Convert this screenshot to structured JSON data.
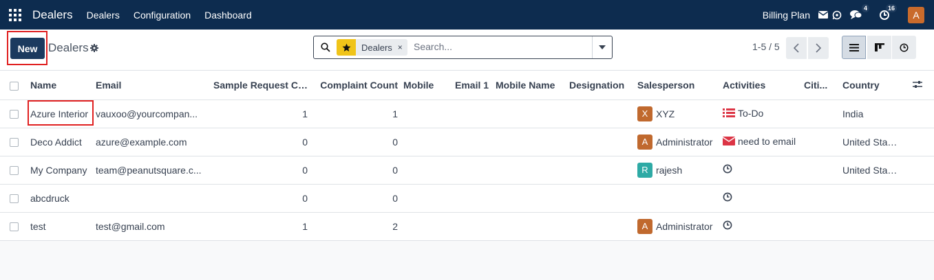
{
  "topnav": {
    "brand": "Dealers",
    "menu": [
      "Dealers",
      "Configuration",
      "Dashboard"
    ],
    "billing": "Billing Plan",
    "chat_badge": "4",
    "activity_badge": "16",
    "user_initial": "A"
  },
  "control": {
    "new_label": "New",
    "title": "Dealers",
    "facet_label": "Dealers",
    "facet_close": "×",
    "search_placeholder": "Search...",
    "pager": "1-5 / 5"
  },
  "table": {
    "headers": [
      "Name",
      "Email",
      "Sample Request Co...",
      "Complaint Count",
      "Mobile",
      "Email 1",
      "Mobile Name",
      "Designation",
      "Salesperson",
      "Activities",
      "Citi...",
      "Country"
    ],
    "rows": [
      {
        "name": "Azure Interior",
        "email": "vauxoo@yourcompan...",
        "sample": "1",
        "complaint": "1",
        "sp_initial": "X",
        "sp_color": "#c0692e",
        "salesperson": "XYZ",
        "activity": "To-Do",
        "activity_icon": "todo-icon",
        "country": "India"
      },
      {
        "name": "Deco Addict",
        "email": "azure@example.com",
        "sample": "0",
        "complaint": "0",
        "sp_initial": "A",
        "sp_color": "#c0692e",
        "salesperson": "Administrator",
        "activity": "need to email",
        "activity_icon": "envelope-icon",
        "country": "United States"
      },
      {
        "name": "My Company",
        "email": "team@peanutsquare.c...",
        "sample": "0",
        "complaint": "0",
        "sp_initial": "R",
        "sp_color": "#2eaaa5",
        "salesperson": "rajesh",
        "activity": "",
        "activity_icon": "clock-icon",
        "country": "United States"
      },
      {
        "name": "abcdruck",
        "email": "",
        "sample": "0",
        "complaint": "0",
        "sp_initial": "",
        "sp_color": "",
        "salesperson": "",
        "activity": "",
        "activity_icon": "clock-icon",
        "country": ""
      },
      {
        "name": "test",
        "email": "test@gmail.com",
        "sample": "1",
        "complaint": "2",
        "sp_initial": "A",
        "sp_color": "#c0692e",
        "salesperson": "Administrator",
        "activity": "",
        "activity_icon": "clock-icon",
        "country": ""
      }
    ]
  },
  "colors": {
    "navbar": "#0d2c4f",
    "primary": "#1b3a5f",
    "highlight": "#e02020",
    "facet_star": "#f0c419",
    "activity_red": "#dc3545"
  }
}
